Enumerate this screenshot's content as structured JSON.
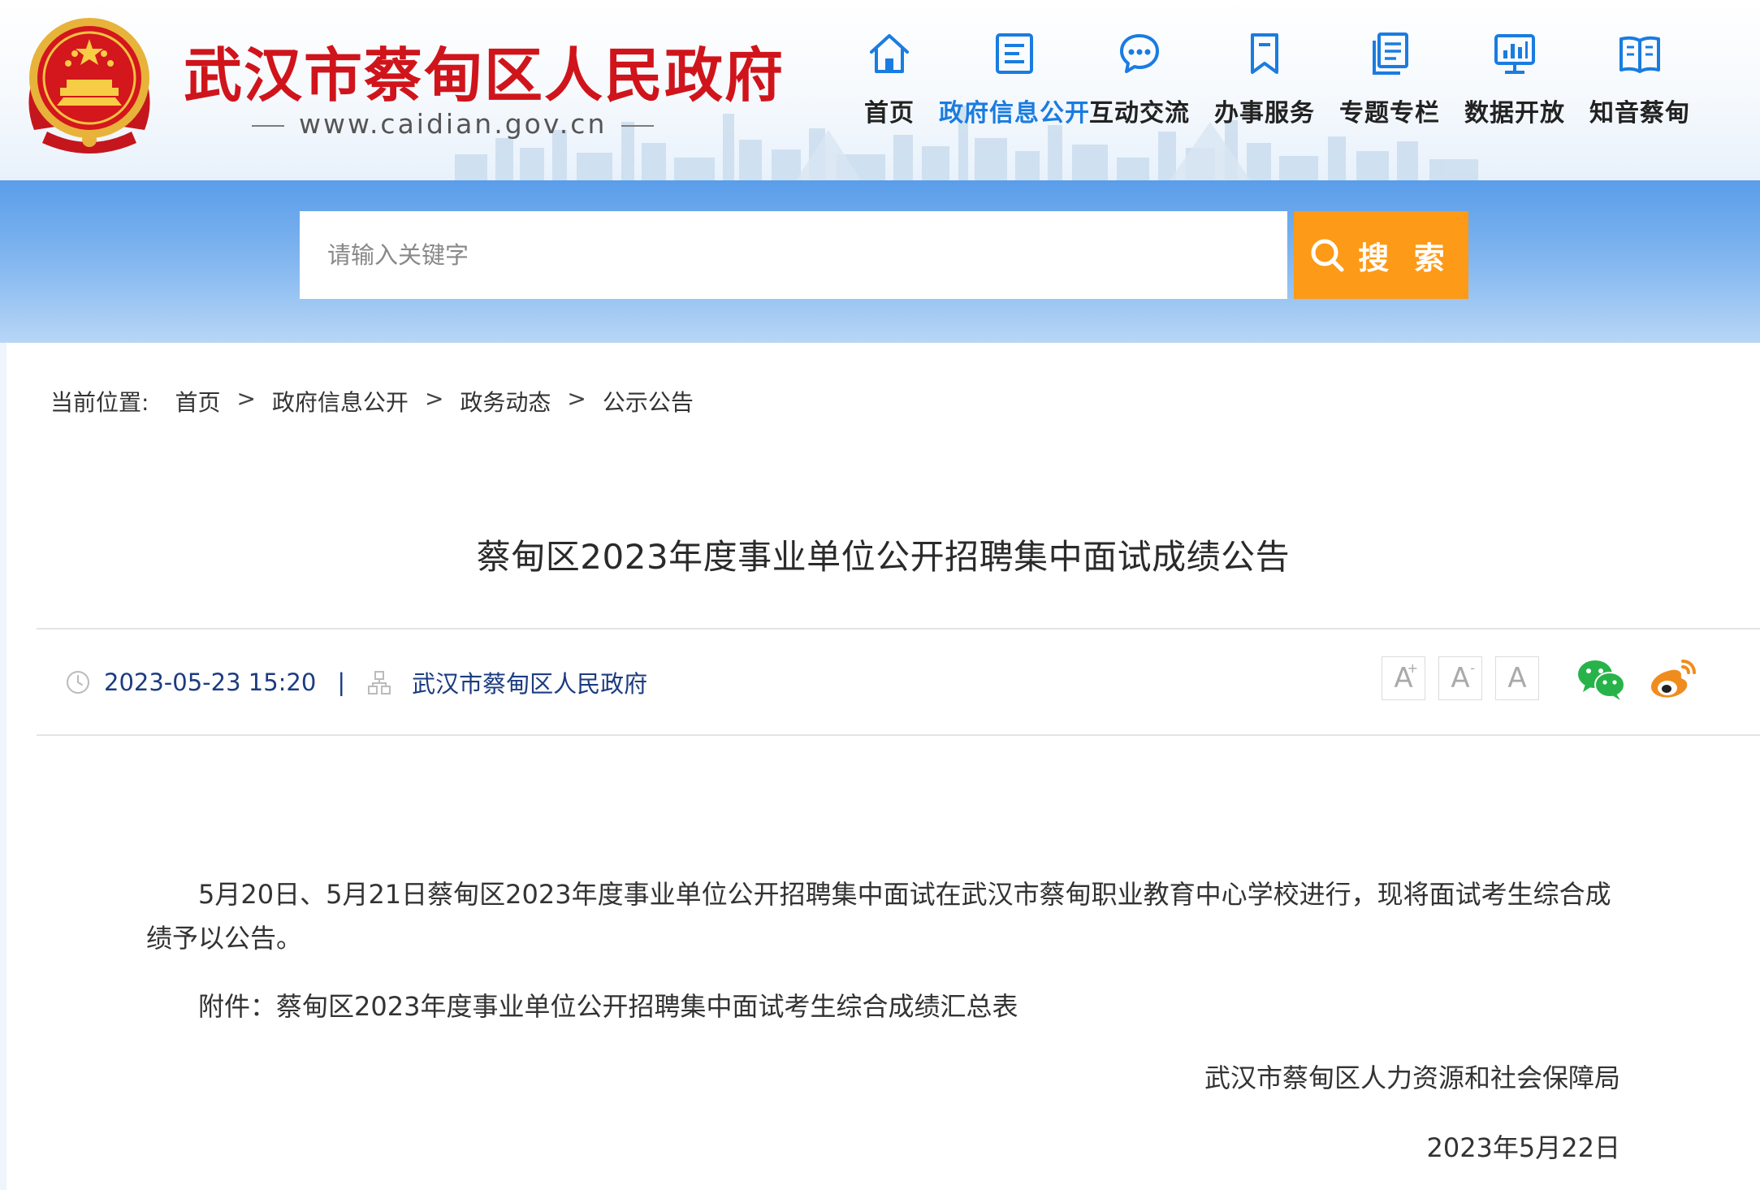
{
  "header": {
    "site_title": "武汉市蔡甸区人民政府",
    "site_url": "www.caidian.gov.cn",
    "nav": [
      {
        "label": "首页",
        "icon": "home-icon",
        "active": false
      },
      {
        "label": "政府信息公开",
        "icon": "document-icon",
        "active": true
      },
      {
        "label": "互动交流",
        "icon": "chat-bubble-icon",
        "active": false
      },
      {
        "label": "办事服务",
        "icon": "bookmark-icon",
        "active": false
      },
      {
        "label": "专题专栏",
        "icon": "stacked-pages-icon",
        "active": false
      },
      {
        "label": "数据开放",
        "icon": "monitor-chart-icon",
        "active": false
      },
      {
        "label": "知音蔡甸",
        "icon": "open-book-icon",
        "active": false
      }
    ],
    "active_color": "#1a7ce0",
    "title_color": "#d0141b"
  },
  "search": {
    "placeholder": "请输入关键字",
    "value": "",
    "button_label": "搜 索",
    "button_color": "#fd9a17"
  },
  "breadcrumb": {
    "lead": "当前位置:",
    "items": [
      "首页",
      "政府信息公开",
      "政务动态",
      "公示公告"
    ],
    "separator": ">"
  },
  "article": {
    "title": "蔡甸区2023年度事业单位公开招聘集中面试成绩公告",
    "date": "2023-05-23 15:20",
    "divider": "|",
    "source": "武汉市蔡甸区人民政府",
    "font_sizes": [
      "A",
      "A",
      "A"
    ],
    "share": [
      "wechat-icon",
      "weibo-icon"
    ],
    "paragraphs": [
      "5月20日、5月21日蔡甸区2023年度事业单位公开招聘集中面试在武汉市蔡甸职业教育中心学校进行，现将面试考生综合成绩予以公告。"
    ],
    "attachment": "附件：蔡甸区2023年度事业单位公开招聘集中面试考生综合成绩汇总表",
    "signature_org": "武汉市蔡甸区人力资源和社会保障局",
    "signature_date": "2023年5月22日"
  }
}
